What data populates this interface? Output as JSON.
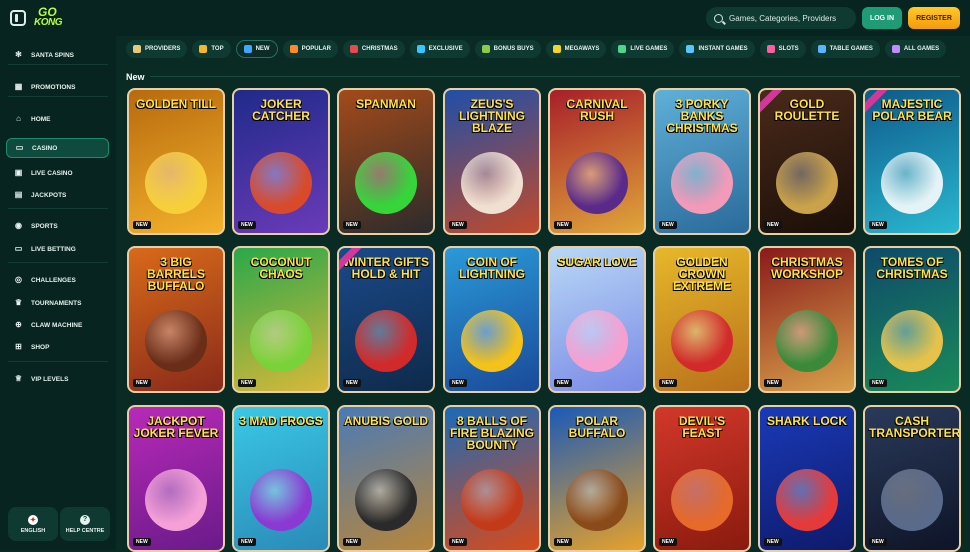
{
  "header": {
    "logo": {
      "line1": "GO",
      "line2": "KONG"
    },
    "search_placeholder": "Games, Categories, Providers",
    "login_label": "LOG IN",
    "register_label": "REGISTER"
  },
  "sidebar": {
    "items": [
      {
        "label": "SANTA SPINS",
        "icon": "snowflake-icon",
        "glyph": "✻"
      },
      {
        "label": "PROMOTIONS",
        "icon": "gift-icon",
        "glyph": "▦"
      },
      {
        "label": "HOME",
        "icon": "home-icon",
        "glyph": "⌂"
      },
      {
        "label": "CASINO",
        "icon": "casino-chip-icon",
        "glyph": "▭"
      },
      {
        "label": "LIVE CASINO",
        "icon": "live-casino-icon",
        "glyph": "▣"
      },
      {
        "label": "JACKPOTS",
        "icon": "jackpot-icon",
        "glyph": "▤"
      },
      {
        "label": "SPORTS",
        "icon": "sports-ball-icon",
        "glyph": "◉"
      },
      {
        "label": "LIVE BETTING",
        "icon": "live-betting-icon",
        "glyph": "▭"
      },
      {
        "label": "CHALLENGES",
        "icon": "challenges-icon",
        "glyph": "◎"
      },
      {
        "label": "TOURNAMENTS",
        "icon": "trophy-icon",
        "glyph": "♛"
      },
      {
        "label": "CLAW MACHINE",
        "icon": "claw-icon",
        "glyph": "⊕"
      },
      {
        "label": "SHOP",
        "icon": "shop-cart-icon",
        "glyph": "⊞"
      },
      {
        "label": "VIP LEVELS",
        "icon": "vip-crown-icon",
        "glyph": "♕"
      }
    ],
    "active": "CASINO",
    "footer": {
      "language_label": "ENGLISH",
      "help_label": "HELP CENTRE"
    }
  },
  "categories": [
    {
      "label": "PROVIDERS",
      "color": "#e7c97a"
    },
    {
      "label": "TOP",
      "color": "#f5b62a"
    },
    {
      "label": "NEW",
      "color": "#3fa7ff"
    },
    {
      "label": "POPULAR",
      "color": "#ff8a2b"
    },
    {
      "label": "CHRISTMAS",
      "color": "#e54b4b"
    },
    {
      "label": "EXCLUSIVE",
      "color": "#37c6ff"
    },
    {
      "label": "BONUS BUYS",
      "color": "#8acb48"
    },
    {
      "label": "MEGAWAYS",
      "color": "#f2d42c"
    },
    {
      "label": "LIVE GAMES",
      "color": "#4fd48a"
    },
    {
      "label": "INSTANT GAMES",
      "color": "#58c6ff"
    },
    {
      "label": "SLOTS",
      "color": "#ff5fa0"
    },
    {
      "label": "TABLE GAMES",
      "color": "#5ab4ff"
    },
    {
      "label": "ALL GAMES",
      "color": "#c28bff"
    }
  ],
  "active_category": "NEW",
  "section": {
    "title": "New"
  },
  "games": [
    {
      "title": "GOLDEN TILL",
      "bg": "#b86a0e",
      "bg2": "#f3b22c",
      "art": "#f6cf3a",
      "ribbon": false
    },
    {
      "title": "JOKER CATCHER",
      "bg": "#1f2a8a",
      "bg2": "#6a3bb8",
      "art": "#d94a2a",
      "ribbon": false
    },
    {
      "title": "SPANMAN",
      "bg": "#a44a1a",
      "bg2": "#2b2b2b",
      "art": "#36d63a",
      "ribbon": false
    },
    {
      "title": "ZEUS'S LIGHTNING BLAZE",
      "bg": "#1f4fa8",
      "bg2": "#c24a2a",
      "art": "#f0e0d2",
      "ribbon": false
    },
    {
      "title": "CARNIVAL RUSH",
      "bg": "#a81f2a",
      "bg2": "#e0a63a",
      "art": "#5a2a8a",
      "ribbon": false
    },
    {
      "title": "3 PORKY BANKS CHRISTMAS",
      "bg": "#5fb0d8",
      "bg2": "#2a6a9a",
      "art": "#f39ab8",
      "ribbon": false
    },
    {
      "title": "GOLD ROULETTE",
      "bg": "#4a2a1a",
      "bg2": "#1a0e08",
      "art": "#c9a24a",
      "ribbon": true
    },
    {
      "title": "MAJESTIC POLAR BEAR",
      "bg": "#0e5a8a",
      "bg2": "#2ab8d0",
      "art": "#e6f3f6",
      "ribbon": true
    },
    {
      "title": "3 BIG BARRELS BUFFALO",
      "bg": "#d86a1a",
      "bg2": "#8a2a1a",
      "art": "#6a2e18",
      "ribbon": false
    },
    {
      "title": "COCONUT CHAOS",
      "bg": "#2aa84a",
      "bg2": "#d8b83a",
      "art": "#7ad23a",
      "ribbon": false
    },
    {
      "title": "WINTER GIFTS HOLD & HIT",
      "bg": "#1a4a8a",
      "bg2": "#0e2a4a",
      "art": "#d22a2a",
      "ribbon": true
    },
    {
      "title": "COIN OF LIGHTNING",
      "bg": "#2a9ad8",
      "bg2": "#1a4a9a",
      "art": "#f4c21a",
      "ribbon": false
    },
    {
      "title": "SUGAR LOVE",
      "bg": "#b8d8f6",
      "bg2": "#7a8ae6",
      "art": "#f6a0d0",
      "ribbon": false
    },
    {
      "title": "GOLDEN CROWN EXTREME",
      "bg": "#e6b82a",
      "bg2": "#b8701a",
      "art": "#d22a2a",
      "ribbon": false
    },
    {
      "title": "CHRISTMAS WORKSHOP",
      "bg": "#8a1a1a",
      "bg2": "#d8a04a",
      "art": "#3a8a3a",
      "ribbon": false
    },
    {
      "title": "TOMES OF CHRISTMAS",
      "bg": "#0e4a6a",
      "bg2": "#1a8a5a",
      "art": "#e6c24a",
      "ribbon": false
    },
    {
      "title": "JACKPOT JOKER FEVER",
      "bg": "#b82ab8",
      "bg2": "#6a1a8a",
      "art": "#f6a0d8",
      "ribbon": false
    },
    {
      "title": "3 MAD FROGS",
      "bg": "#3ac8e6",
      "bg2": "#2a8ab8",
      "art": "#8a3ad2",
      "ribbon": false
    },
    {
      "title": "ANUBIS GOLD",
      "bg": "#4a7ab8",
      "bg2": "#b8863a",
      "art": "#2a2a2a",
      "ribbon": false
    },
    {
      "title": "8 BALLS OF FIRE BLAZING BOUNTY",
      "bg": "#1a6ab8",
      "bg2": "#d84a1a",
      "art": "#c23a1a",
      "ribbon": false
    },
    {
      "title": "POLAR BUFFALO",
      "bg": "#1a5ab8",
      "bg2": "#e6a22a",
      "art": "#8a4a1a",
      "ribbon": false
    },
    {
      "title": "DEVIL'S FEAST",
      "bg": "#d2382a",
      "bg2": "#8a1a0e",
      "art": "#e66a2a",
      "ribbon": false
    },
    {
      "title": "SHARK LOCK",
      "bg": "#1a3ab8",
      "bg2": "#0e1a6a",
      "art": "#e63a3a",
      "ribbon": false
    },
    {
      "title": "CASH TRANSPORTER",
      "bg": "#2a3a5a",
      "bg2": "#0e1428",
      "art": "#5a6a8a",
      "ribbon": false
    }
  ],
  "new_badge": "NEW"
}
